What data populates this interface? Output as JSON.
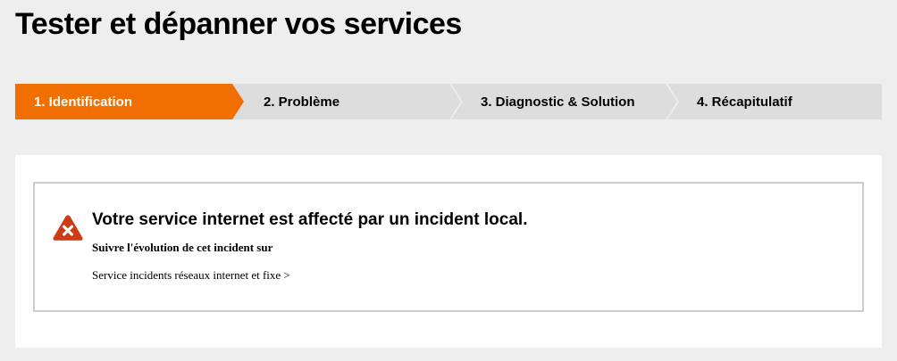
{
  "page": {
    "title": "Tester et dépanner vos services"
  },
  "stepper": {
    "steps": [
      {
        "label": "1. Identification",
        "active": true
      },
      {
        "label": "2. Problème",
        "active": false
      },
      {
        "label": "3. Diagnostic & Solution",
        "active": false
      },
      {
        "label": "4. Récapitulatif",
        "active": false
      }
    ],
    "active_color": "#f16e00",
    "inactive_color": "#dddddd"
  },
  "alert": {
    "icon": "error-warning-triangle-icon",
    "icon_color": "#cd3c14",
    "title": "Votre service internet est affecté par un incident local.",
    "subtitle": "Suivre l'évolution de cet incident sur",
    "link_text": "Service incidents réseaux internet et fixe >"
  }
}
